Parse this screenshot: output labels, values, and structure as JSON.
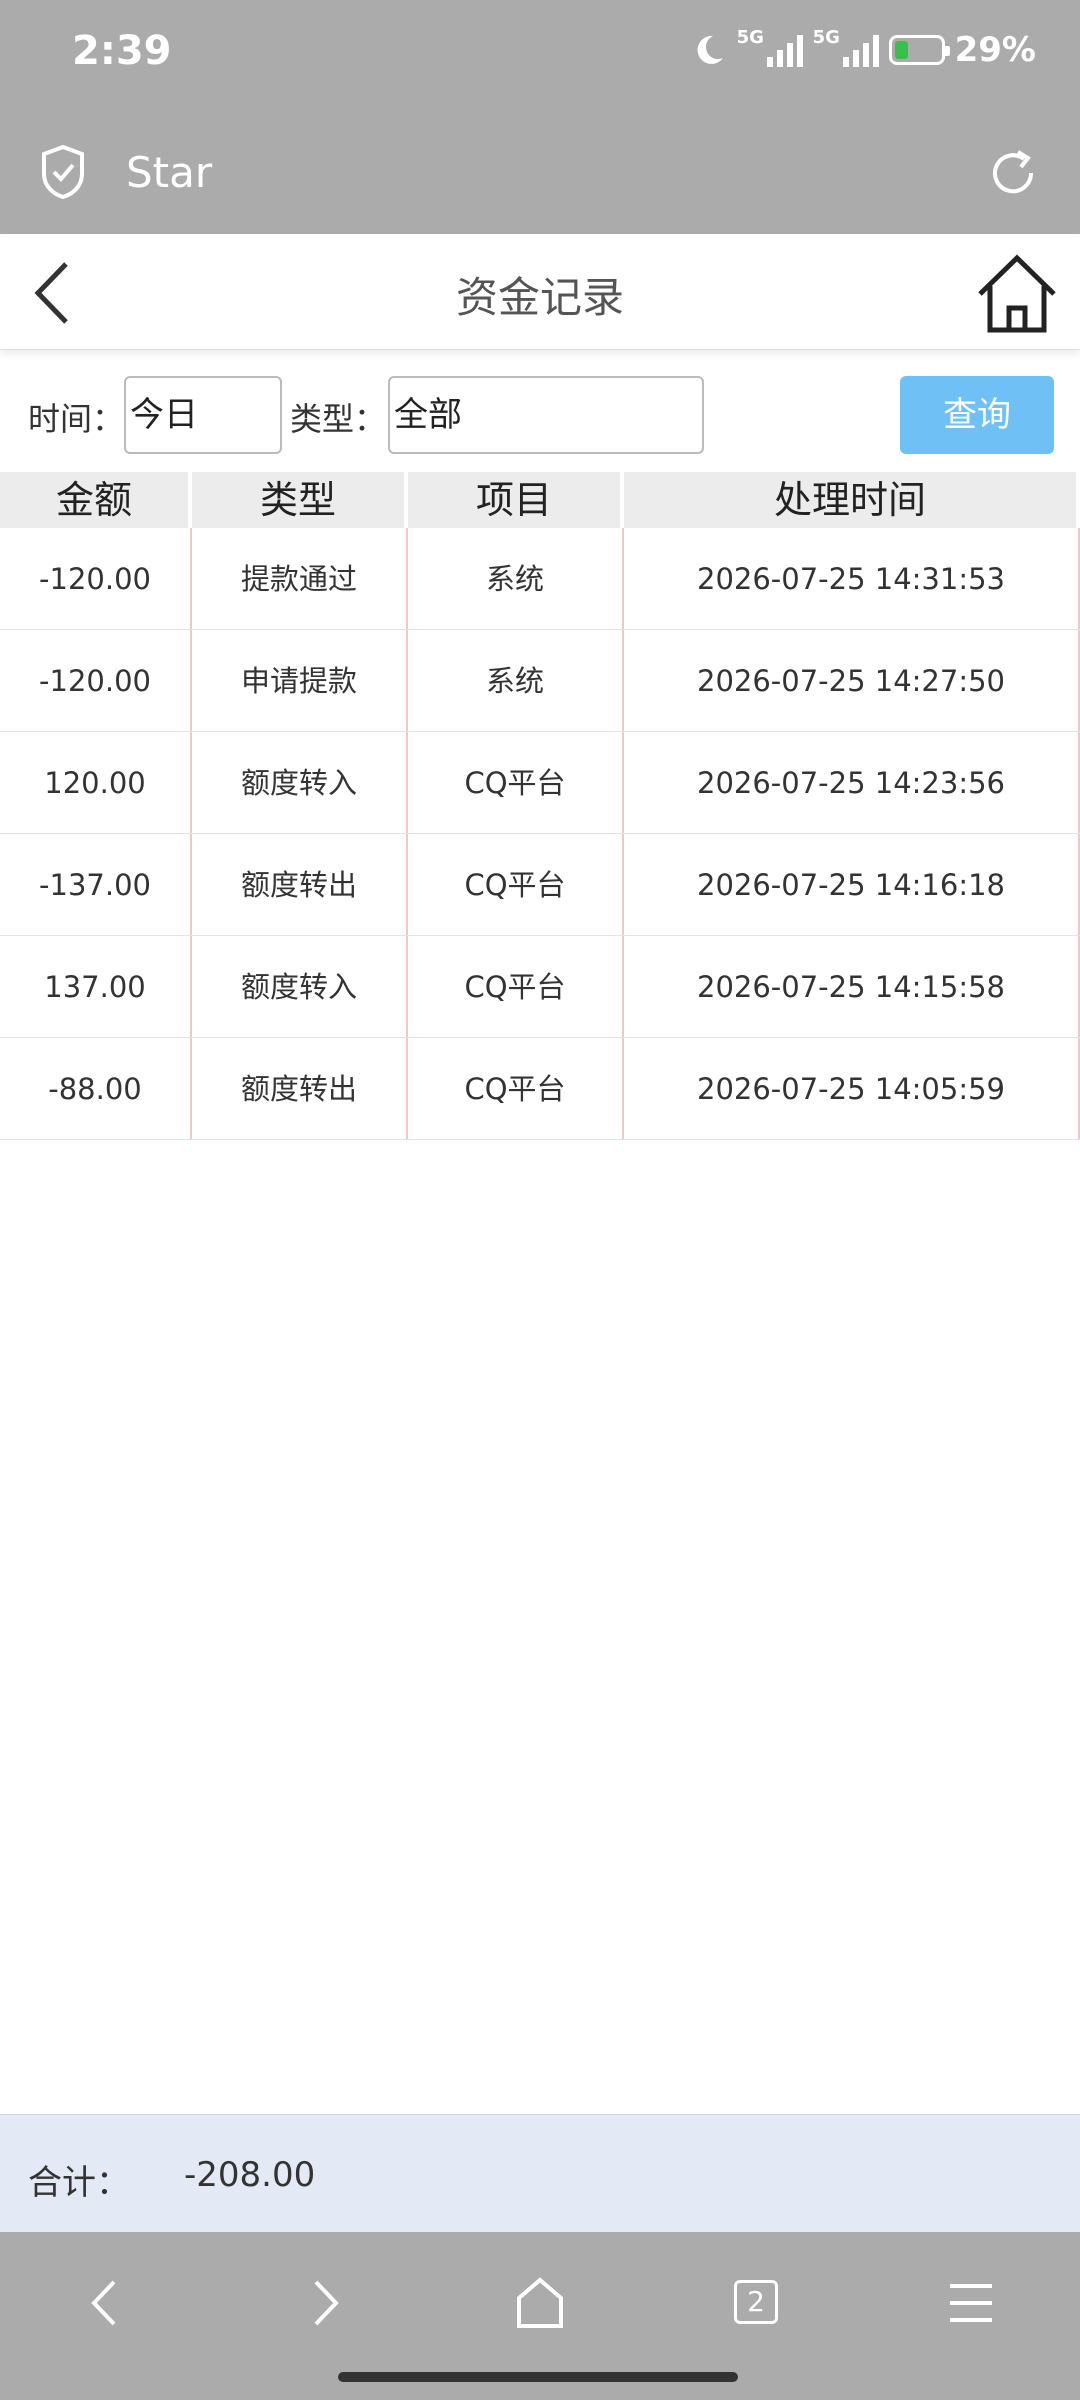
{
  "status_bar": {
    "time": "2:39",
    "network1": "5G",
    "network2": "5G",
    "battery_level": "29%",
    "battery_fraction": 0.29
  },
  "browser": {
    "site_name": "Star"
  },
  "header": {
    "title": "资金记录"
  },
  "filters": {
    "time_label": "时间：",
    "time_value": "今日",
    "type_label": "类型：",
    "type_value": "全部",
    "query_button": "查询"
  },
  "table": {
    "columns": [
      "金额",
      "类型",
      "项目",
      "处理时间"
    ],
    "rows": [
      {
        "amount": "-120.00",
        "type": "提款通过",
        "item": "系统",
        "time": "2026-07-25 14:31:53"
      },
      {
        "amount": "-120.00",
        "type": "申请提款",
        "item": "系统",
        "time": "2026-07-25 14:27:50"
      },
      {
        "amount": "120.00",
        "type": "额度转入",
        "item": "CQ平台",
        "time": "2026-07-25 14:23:56"
      },
      {
        "amount": "-137.00",
        "type": "额度转出",
        "item": "CQ平台",
        "time": "2026-07-25 14:16:18"
      },
      {
        "amount": "137.00",
        "type": "额度转入",
        "item": "CQ平台",
        "time": "2026-07-25 14:15:58"
      },
      {
        "amount": "-88.00",
        "type": "额度转出",
        "item": "CQ平台",
        "time": "2026-07-25 14:05:59"
      }
    ]
  },
  "total": {
    "label": "合计：",
    "value": "-208.00"
  },
  "nav": {
    "tab_count": "2"
  },
  "colors": {
    "query_button": "#6fc1f5",
    "total_bar": "#e3eaf6",
    "chrome_gray": "#ababab",
    "battery_fill": "#36c24a"
  }
}
